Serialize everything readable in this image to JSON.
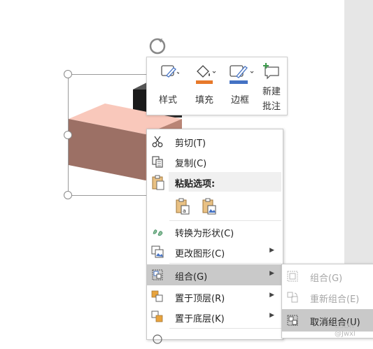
{
  "mini_toolbar": {
    "style_label": "样式",
    "fill_label": "填充",
    "border_label": "边框",
    "new_comment_line1": "新建",
    "new_comment_line2": "批注",
    "fill_color": "#e7792a",
    "border_color": "#4472c4"
  },
  "context_menu": {
    "cut": "剪切(T)",
    "copy": "复制(C)",
    "paste_options": "粘贴选项:",
    "convert_to_shape": "转换为形状(C)",
    "change_graphic": "更改图形(C)",
    "group": "组合(G)",
    "bring_to_front": "置于顶层(R)",
    "send_to_back": "置于底层(K)"
  },
  "submenu": {
    "group": "组合(G)",
    "regroup": "重新组合(E)",
    "ungroup": "取消组合(U)"
  },
  "watermark": "CSDN @Jwxl",
  "colors": {
    "box_front": "#9c7065",
    "box_top": "#f9c8bb",
    "dark_box": "#2b2b2b",
    "highlight": "#c9c9c9"
  }
}
